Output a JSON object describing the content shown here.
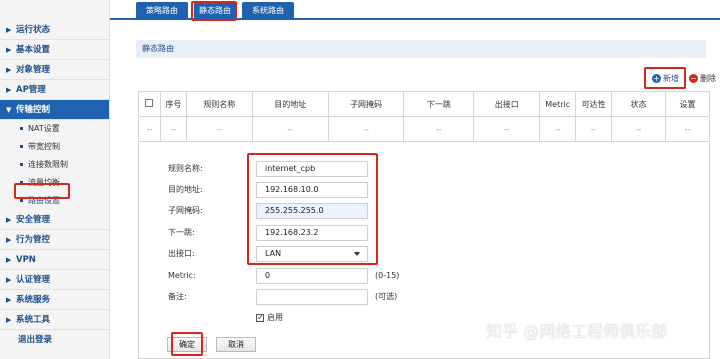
{
  "sidebar": {
    "items": [
      {
        "label": "运行状态"
      },
      {
        "label": "基本设置"
      },
      {
        "label": "对象管理"
      },
      {
        "label": "AP管理"
      },
      {
        "label": "传输控制"
      }
    ],
    "sub_items": [
      {
        "label": "NAT设置"
      },
      {
        "label": "带宽控制"
      },
      {
        "label": "连接数限制"
      },
      {
        "label": "流量均衡"
      },
      {
        "label": "路由设置"
      }
    ],
    "items_after": [
      {
        "label": "安全管理"
      },
      {
        "label": "行为管控"
      },
      {
        "label": "VPN"
      },
      {
        "label": "认证管理"
      },
      {
        "label": "系统服务"
      },
      {
        "label": "系统工具"
      }
    ],
    "logout_label": "退出登录"
  },
  "tabs": [
    {
      "label": "策略路由"
    },
    {
      "label": "静态路由"
    },
    {
      "label": "系统路由"
    }
  ],
  "section_title": "静态路由",
  "toolbar": {
    "add_label": "新增",
    "delete_label": "删除"
  },
  "table": {
    "headers": [
      "序号",
      "规则名称",
      "目的地址",
      "子网掩码",
      "下一跳",
      "出接口",
      "Metric",
      "可达性",
      "状态",
      "设置"
    ],
    "empty_cell": "--"
  },
  "form": {
    "rule_name": {
      "label": "规则名称:",
      "value": "internet_cpb"
    },
    "dest_addr": {
      "label": "目的地址:",
      "value": "192.168.10.0"
    },
    "subnet_mask": {
      "label": "子网掩码:",
      "value": "255.255.255.0"
    },
    "next_hop": {
      "label": "下一跳:",
      "value": "192.168.23.2"
    },
    "out_iface": {
      "label": "出接口:",
      "value": "LAN"
    },
    "metric": {
      "label": "Metric:",
      "value": "0",
      "hint": "(0-15)"
    },
    "remark": {
      "label": "备注:",
      "value": "",
      "hint": "(可选)"
    },
    "enable_label": "启用",
    "ok_label": "确定",
    "cancel_label": "取消"
  },
  "watermark": "知乎 @网络工程师俱乐部",
  "colors": {
    "accent": "#1f62b0",
    "highlight": "#d9251d",
    "link": "#1f4f8a"
  }
}
